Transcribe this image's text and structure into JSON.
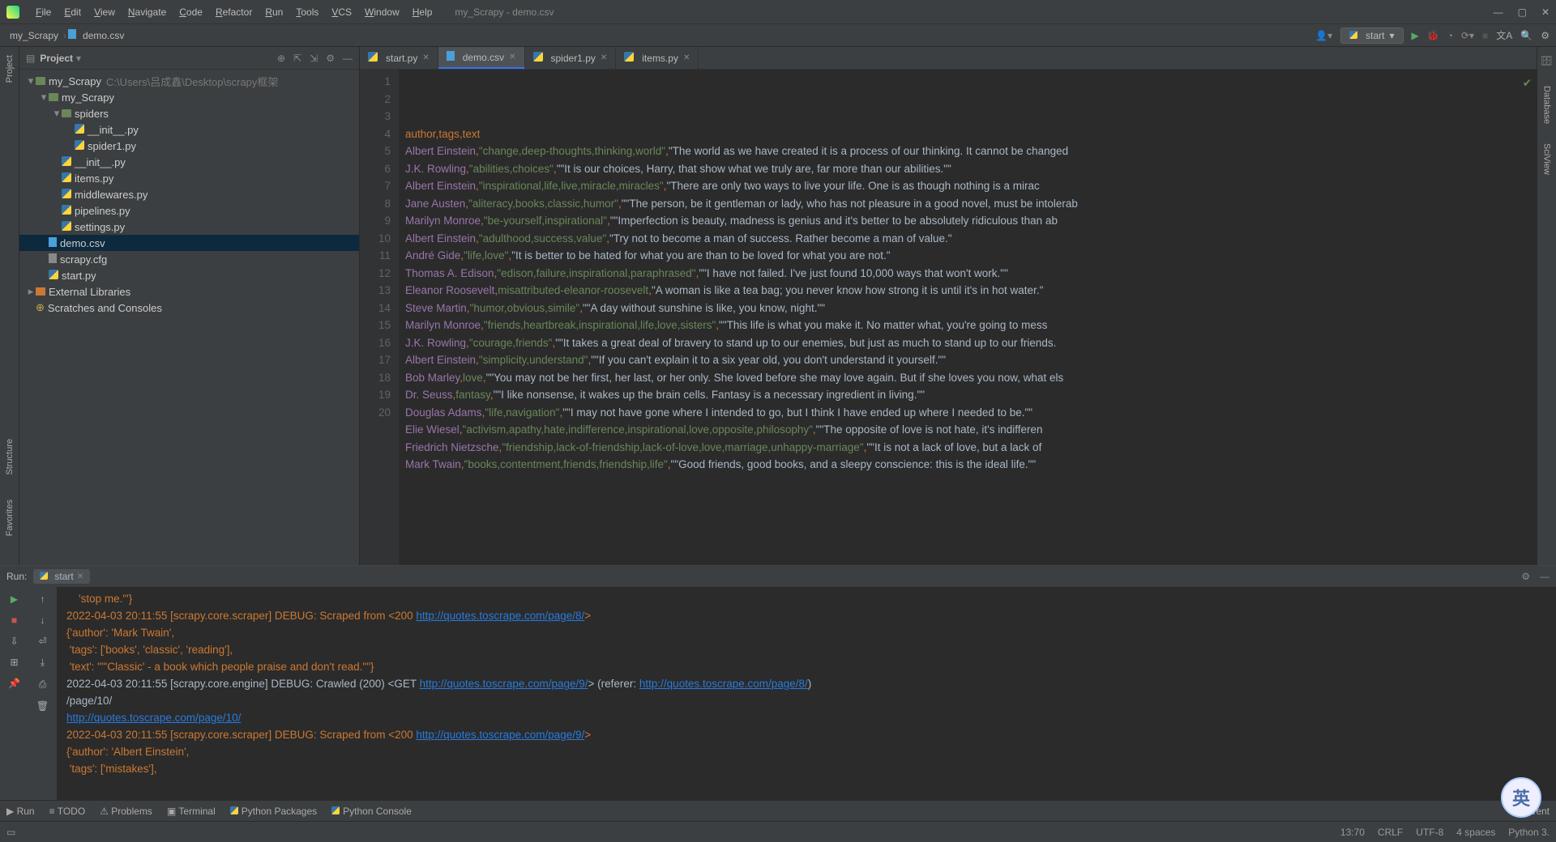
{
  "window": {
    "title": "my_Scrapy - demo.csv"
  },
  "menus": [
    "File",
    "Edit",
    "View",
    "Navigate",
    "Code",
    "Refactor",
    "Run",
    "Tools",
    "VCS",
    "Window",
    "Help"
  ],
  "breadcrumbs": [
    "my_Scrapy",
    "demo.csv"
  ],
  "toolbar": {
    "run_config": "start"
  },
  "left_tool_windows": [
    "Project",
    "Structure",
    "Favorites"
  ],
  "right_tool_windows": [
    "Database",
    "SciView"
  ],
  "project_panel": {
    "title": "Project",
    "root_name": "my_Scrapy",
    "root_path": "C:\\Users\\吕成鑫\\Desktop\\scrapy框架",
    "tree": [
      {
        "d": 1,
        "t": "folder",
        "n": "my_Scrapy",
        "e": true
      },
      {
        "d": 2,
        "t": "folder",
        "n": "spiders",
        "e": true
      },
      {
        "d": 3,
        "t": "py",
        "n": "__init__.py"
      },
      {
        "d": 3,
        "t": "py",
        "n": "spider1.py"
      },
      {
        "d": 2,
        "t": "py",
        "n": "__init__.py"
      },
      {
        "d": 2,
        "t": "py",
        "n": "items.py"
      },
      {
        "d": 2,
        "t": "py",
        "n": "middlewares.py"
      },
      {
        "d": 2,
        "t": "py",
        "n": "pipelines.py"
      },
      {
        "d": 2,
        "t": "py",
        "n": "settings.py"
      },
      {
        "d": 1,
        "t": "csv",
        "n": "demo.csv",
        "sel": true
      },
      {
        "d": 1,
        "t": "file",
        "n": "scrapy.cfg"
      },
      {
        "d": 1,
        "t": "py",
        "n": "start.py"
      }
    ],
    "external_libs": "External Libraries",
    "scratches": "Scratches and Consoles"
  },
  "editor_tabs": [
    {
      "label": "start.py",
      "type": "py"
    },
    {
      "label": "demo.csv",
      "type": "csv",
      "active": true
    },
    {
      "label": "spider1.py",
      "type": "py"
    },
    {
      "label": "items.py",
      "type": "py"
    }
  ],
  "csv_header": [
    "author",
    "tags",
    "text"
  ],
  "csv_rows": [
    {
      "a": "Albert Einstein",
      "t": "\"change,deep-thoughts,thinking,world\"",
      "x": "\"The world as we have created it is a process of our thinking. It cannot be changed"
    },
    {
      "a": "J.K. Rowling",
      "t": "\"abilities,choices\"",
      "x": "\"\"It is our choices, Harry, that show what we truly are, far more than our abilities.\"\""
    },
    {
      "a": "Albert Einstein",
      "t": "\"inspirational,life,live,miracle,miracles\"",
      "x": "\"There are only two ways to live your life. One is as though nothing is a mirac"
    },
    {
      "a": "Jane Austen",
      "t": "\"aliteracy,books,classic,humor\"",
      "x": "\"\"The person, be it gentleman or lady, who has not pleasure in a good novel, must be intolerab"
    },
    {
      "a": "Marilyn Monroe",
      "t": "\"be-yourself,inspirational\"",
      "x": "\"\"Imperfection is beauty, madness is genius and it's better to be absolutely ridiculous than ab"
    },
    {
      "a": "Albert Einstein",
      "t": "\"adulthood,success,value\"",
      "x": "\"Try not to become a man of success. Rather become a man of value.\""
    },
    {
      "a": "André Gide",
      "t": "\"life,love\"",
      "x": "\"It is better to be hated for what you are than to be loved for what you are not.\""
    },
    {
      "a": "Thomas A. Edison",
      "t": "\"edison,failure,inspirational,paraphrased\"",
      "x": "\"\"I have not failed. I've just found 10,000 ways that won't work.\"\""
    },
    {
      "a": "Eleanor Roosevelt",
      "t": "misattributed-eleanor-roosevelt",
      "x": "\"A woman is like a tea bag; you never know how strong it is until it's in hot water.\""
    },
    {
      "a": "Steve Martin",
      "t": "\"humor,obvious,simile\"",
      "x": "\"\"A day without sunshine is like, you know, night.\"\""
    },
    {
      "a": "Marilyn Monroe",
      "t": "\"friends,heartbreak,inspirational,life,love,sisters\"",
      "x": "\"\"This life is what you make it. No matter what, you're going to mess "
    },
    {
      "a": "J.K. Rowling",
      "t": "\"courage,friends\"",
      "x": "\"\"It takes a great deal of bravery to stand up to our enemies, but just as much to stand up to our friends."
    },
    {
      "a": "Albert Einstein",
      "t": "\"simplicity,understand\"",
      "x": "\"\"If you can't explain it to a six year old, you don't understand it yourself.\"\""
    },
    {
      "a": "Bob Marley",
      "t": "love",
      "x": "\"\"You may not be her first, her last, or her only. She loved before she may love again. But if she loves you now, what els"
    },
    {
      "a": "Dr. Seuss",
      "t": "fantasy",
      "x": "\"\"I like nonsense, it wakes up the brain cells. Fantasy is a necessary ingredient in living.\"\""
    },
    {
      "a": "Douglas Adams",
      "t": "\"life,navigation\"",
      "x": "\"\"I may not have gone where I intended to go, but I think I have ended up where I needed to be.\"\""
    },
    {
      "a": "Elie Wiesel",
      "t": "\"activism,apathy,hate,indifference,inspirational,love,opposite,philosophy\"",
      "x": "\"\"The opposite of love is not hate, it's indifferen"
    },
    {
      "a": "Friedrich Nietzsche",
      "t": "\"friendship,lack-of-friendship,lack-of-love,love,marriage,unhappy-marriage\"",
      "x": "\"\"It is not a lack of love, but a lack of "
    },
    {
      "a": "Mark Twain",
      "t": "\"books,contentment,friends,friendship,life\"",
      "x": "\"\"Good friends, good books, and a sleepy conscience: this is the ideal life.\"\""
    }
  ],
  "run_panel": {
    "label": "Run:",
    "tab": "start",
    "lines": [
      {
        "parts": [
          {
            "c": "orange",
            "t": "    'stop me.\"'}"
          }
        ]
      },
      {
        "parts": [
          {
            "c": "orange",
            "t": "2022-04-03 20:11:55 [scrapy.core.scraper] DEBUG: Scraped from <200 "
          },
          {
            "c": "link",
            "t": "http://quotes.toscrape.com/page/8/"
          },
          {
            "c": "orange",
            "t": ">"
          }
        ]
      },
      {
        "parts": [
          {
            "c": "orange",
            "t": "{'author': 'Mark Twain',"
          }
        ]
      },
      {
        "parts": [
          {
            "c": "orange",
            "t": " 'tags': ['books', 'classic', 'reading'],"
          }
        ]
      },
      {
        "parts": [
          {
            "c": "orange",
            "t": " 'text': \"\"'Classic' - a book which people praise and don't read.\"\"}"
          }
        ]
      },
      {
        "parts": [
          {
            "c": "default",
            "t": "2022-04-03 20:11:55 [scrapy.core.engine] DEBUG: Crawled (200) <GET "
          },
          {
            "c": "link",
            "t": "http://quotes.toscrape.com/page/9/"
          },
          {
            "c": "default",
            "t": "> (referer: "
          },
          {
            "c": "link",
            "t": "http://quotes.toscrape.com/page/8/"
          },
          {
            "c": "default",
            "t": ")"
          }
        ]
      },
      {
        "parts": [
          {
            "c": "default",
            "t": "/page/10/"
          }
        ]
      },
      {
        "parts": [
          {
            "c": "link",
            "t": "http://quotes.toscrape.com/page/10/"
          }
        ]
      },
      {
        "parts": [
          {
            "c": "orange",
            "t": "2022-04-03 20:11:55 [scrapy.core.scraper] DEBUG: Scraped from <200 "
          },
          {
            "c": "link",
            "t": "http://quotes.toscrape.com/page/9/"
          },
          {
            "c": "orange",
            "t": ">"
          }
        ]
      },
      {
        "parts": [
          {
            "c": "orange",
            "t": "{'author': 'Albert Einstein',"
          }
        ]
      },
      {
        "parts": [
          {
            "c": "orange",
            "t": " 'tags': ['mistakes'],"
          }
        ]
      }
    ]
  },
  "bottom_tabs": [
    "Run",
    "TODO",
    "Problems",
    "Terminal",
    "Python Packages",
    "Python Console"
  ],
  "event_log": "Event",
  "status_bar": {
    "pos": "13:70",
    "eol": "CRLF",
    "enc": "UTF-8",
    "indent": "4 spaces",
    "python": "Python 3."
  },
  "ime": "英"
}
